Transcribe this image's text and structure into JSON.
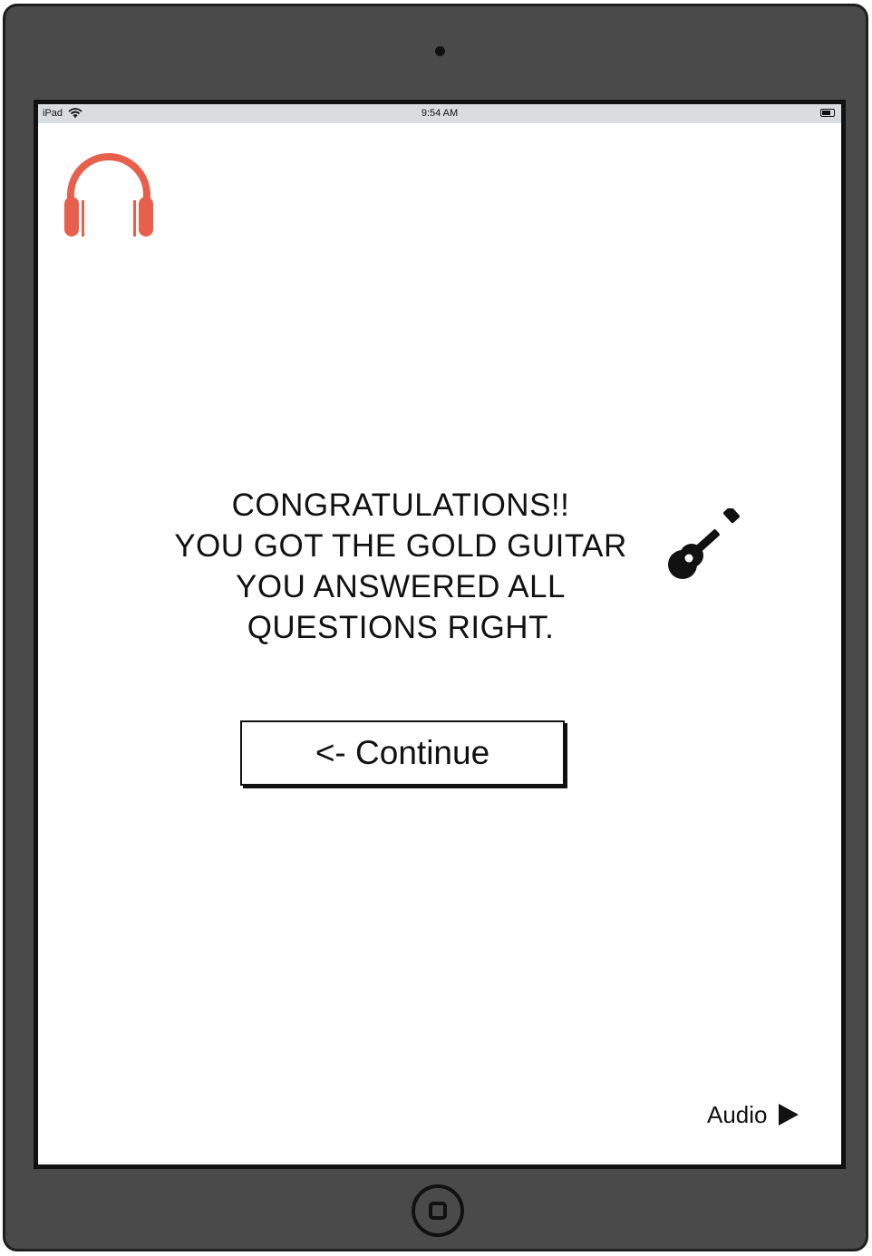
{
  "status_bar": {
    "carrier": "iPad",
    "time": "9:54 AM"
  },
  "logo": {
    "icon": "headphones-icon",
    "color": "#e8604c"
  },
  "message": {
    "line1": "CONGRATULATIONS!!",
    "line2": "YOU GOT THE GOLD GUITAR",
    "line3": "YOU ANSWERED ALL",
    "line4": "QUESTIONS RIGHT."
  },
  "award_icon": "guitar-icon",
  "continue_button": {
    "label": "<- Continue"
  },
  "audio": {
    "label": "Audio",
    "icon": "play-icon"
  }
}
